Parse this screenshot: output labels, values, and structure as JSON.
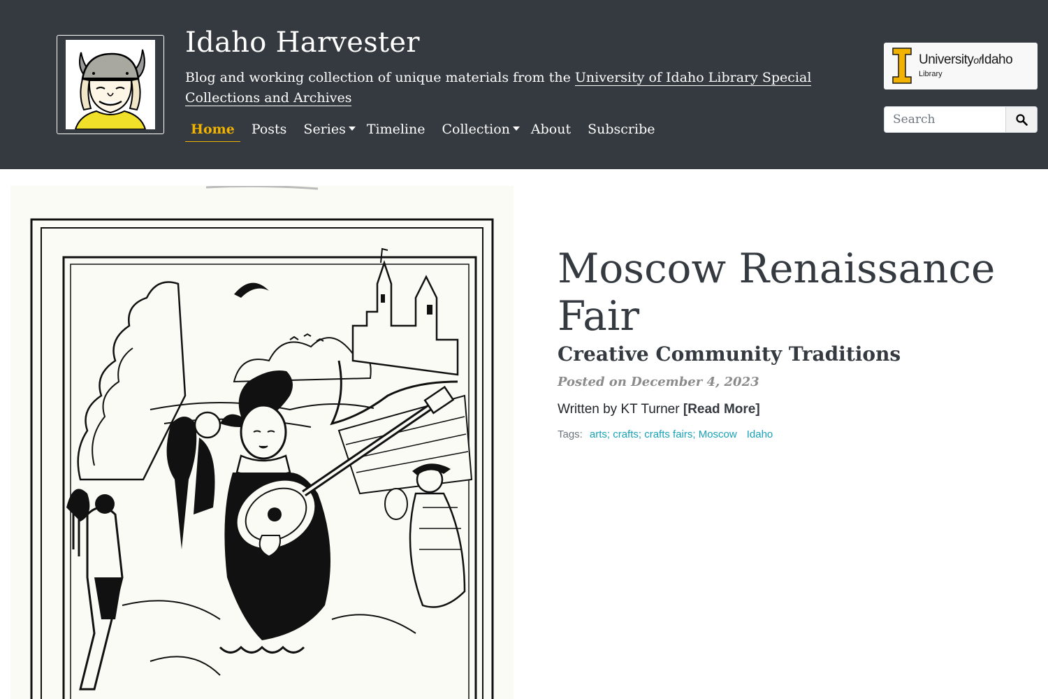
{
  "header": {
    "site_title": "Idaho Harvester",
    "description_prefix": "Blog and working collection of unique materials from the ",
    "description_link": "University of Idaho Library Special Collections and Archives",
    "logo_alt": "Harvester mascot logo"
  },
  "nav": {
    "items": [
      {
        "label": "Home",
        "active": true
      },
      {
        "label": "Posts",
        "active": false
      },
      {
        "label": "Series",
        "dropdown": true
      },
      {
        "label": "Timeline",
        "active": false
      },
      {
        "label": "Collection",
        "dropdown": true
      },
      {
        "label": "About",
        "active": false
      },
      {
        "label": "Subscribe",
        "active": false
      }
    ]
  },
  "university_logo": {
    "name_main": "University",
    "name_of": "of",
    "name_end": "Idaho",
    "sub": "Library"
  },
  "search": {
    "placeholder": "Search",
    "button_icon": "search-icon"
  },
  "feature": {
    "title": "Moscow Renaissance Fair",
    "subtitle": "Creative Community Traditions",
    "date": "Posted on December 4, 2023",
    "byline": "Written by KT Turner ",
    "read_more": "[Read More]",
    "tags_label": "Tags:",
    "tags": [
      "arts; crafts; crafts fairs; Moscow",
      "Idaho"
    ]
  },
  "colors": {
    "header_bg": "#343a40",
    "accent": "#f1b300",
    "tag_link": "#17a2b8",
    "date_gray": "#8b8b8b"
  }
}
